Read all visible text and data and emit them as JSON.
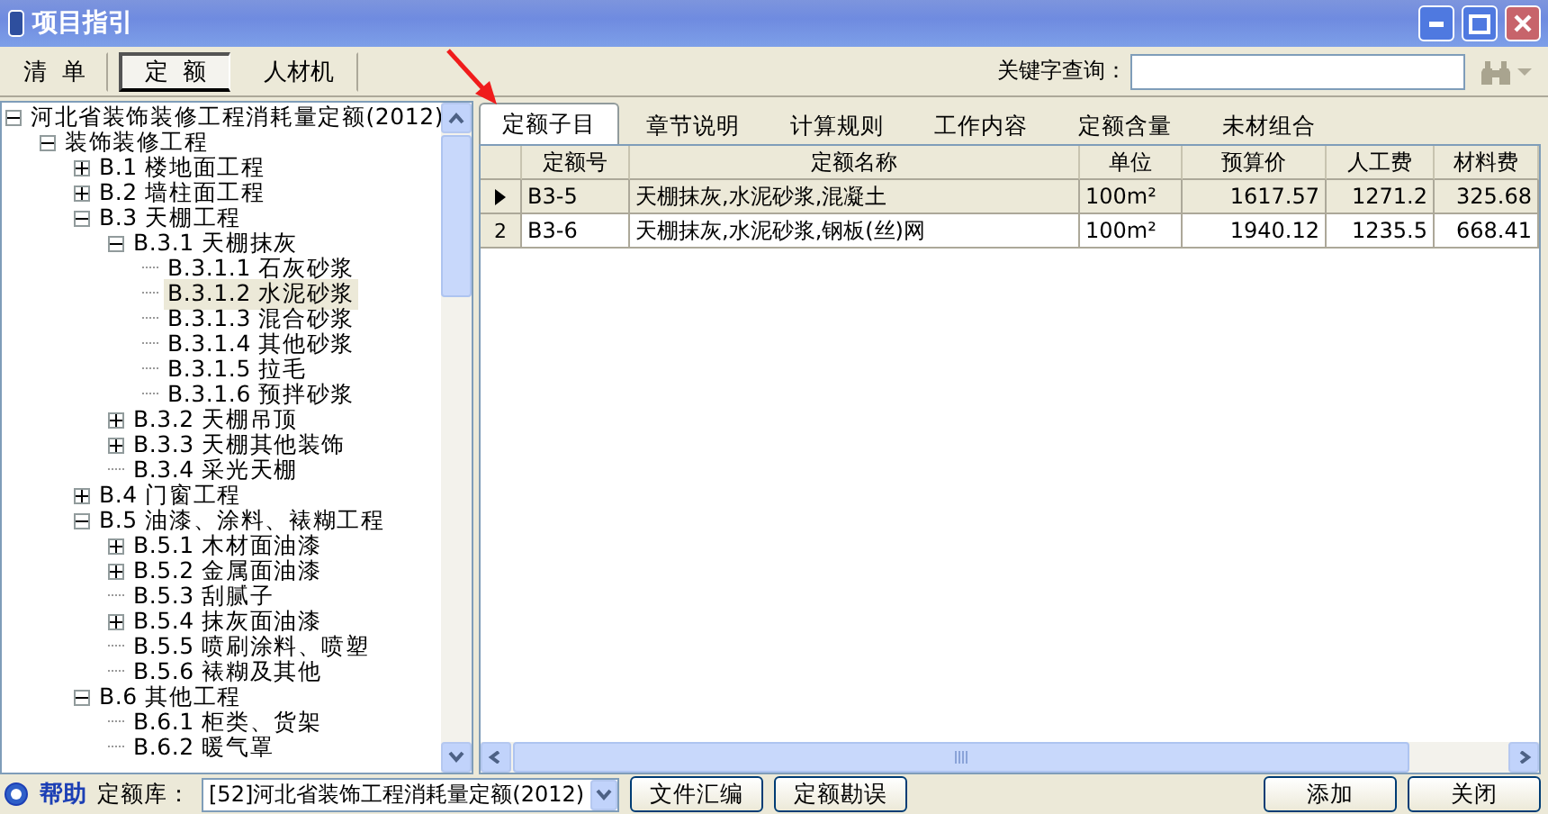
{
  "window": {
    "title": "项目指引"
  },
  "toolbar": {
    "tabs": [
      {
        "label": "清  单",
        "selected": false
      },
      {
        "label": "定  额",
        "selected": true
      },
      {
        "label": "人材机",
        "selected": false
      }
    ],
    "search": {
      "label": "关键字查询："
    }
  },
  "tree": [
    {
      "label": "河北省装饰装修工程消耗量定额(2012)",
      "expanded": true,
      "selected": false,
      "children": [
        {
          "label": "装饰装修工程",
          "expanded": true,
          "selected": false,
          "children": [
            {
              "label": "B.1 楼地面工程",
              "expanded": false,
              "selected": false
            },
            {
              "label": "B.2 墙柱面工程",
              "expanded": false,
              "selected": false
            },
            {
              "label": "B.3 天棚工程",
              "expanded": true,
              "selected": false,
              "children": [
                {
                  "label": "B.3.1 天棚抹灰",
                  "expanded": true,
                  "selected": false,
                  "children": [
                    {
                      "label": "B.3.1.1 石灰砂浆",
                      "selected": false
                    },
                    {
                      "label": "B.3.1.2 水泥砂浆",
                      "selected": true
                    },
                    {
                      "label": "B.3.1.3 混合砂浆",
                      "selected": false
                    },
                    {
                      "label": "B.3.1.4 其他砂浆",
                      "selected": false
                    },
                    {
                      "label": "B.3.1.5 拉毛",
                      "selected": false
                    },
                    {
                      "label": "B.3.1.6 预拌砂浆",
                      "selected": false
                    }
                  ]
                },
                {
                  "label": "B.3.2 天棚吊顶",
                  "expanded": false,
                  "selected": false
                },
                {
                  "label": "B.3.3 天棚其他装饰",
                  "expanded": false,
                  "selected": false
                },
                {
                  "label": "B.3.4 采光天棚",
                  "selected": false
                }
              ]
            },
            {
              "label": "B.4 门窗工程",
              "expanded": false,
              "selected": false
            },
            {
              "label": "B.5 油漆、涂料、裱糊工程",
              "expanded": true,
              "selected": false,
              "children": [
                {
                  "label": "B.5.1 木材面油漆",
                  "expanded": false,
                  "selected": false
                },
                {
                  "label": "B.5.2 金属面油漆",
                  "expanded": false,
                  "selected": false
                },
                {
                  "label": "B.5.3 刮腻子",
                  "selected": false
                },
                {
                  "label": "B.5.4 抹灰面油漆",
                  "expanded": false,
                  "selected": false
                },
                {
                  "label": "B.5.5 喷刷涂料、喷塑",
                  "selected": false
                },
                {
                  "label": "B.5.6 裱糊及其他",
                  "selected": false
                }
              ]
            },
            {
              "label": "B.6 其他工程",
              "expanded": true,
              "selected": false,
              "children": [
                {
                  "label": "B.6.1 柜类、货架",
                  "selected": false
                },
                {
                  "label": "B.6.2 暖气罩",
                  "selected": false
                }
              ]
            }
          ]
        }
      ]
    }
  ],
  "detail_tabs": [
    {
      "label": "定额子目",
      "selected": true
    },
    {
      "label": "章节说明",
      "selected": false
    },
    {
      "label": "计算规则",
      "selected": false
    },
    {
      "label": "工作内容",
      "selected": false
    },
    {
      "label": "定额含量",
      "selected": false
    },
    {
      "label": "未材组合",
      "selected": false
    }
  ],
  "table": {
    "columns": [
      "定额号",
      "定额名称",
      "单位",
      "预算价",
      "人工费",
      "材料费"
    ],
    "rows": [
      {
        "marker": "",
        "selected": true,
        "cells": [
          "B3-5",
          "天棚抹灰,水泥砂浆,混凝土",
          "100m²",
          "1617.57",
          "1271.2",
          "325.68"
        ]
      },
      {
        "marker": "2",
        "selected": false,
        "cells": [
          "B3-6",
          "天棚抹灰,水泥砂浆,钢板(丝)网",
          "100m²",
          "1940.12",
          "1235.5",
          "668.41"
        ]
      }
    ]
  },
  "footer": {
    "help": "帮助",
    "library_label": "定额库：",
    "library": "[52]河北省装饰工程消耗量定额(2012)",
    "buttons": [
      "文件汇编",
      "定额勘误",
      "添加",
      "关闭"
    ]
  }
}
